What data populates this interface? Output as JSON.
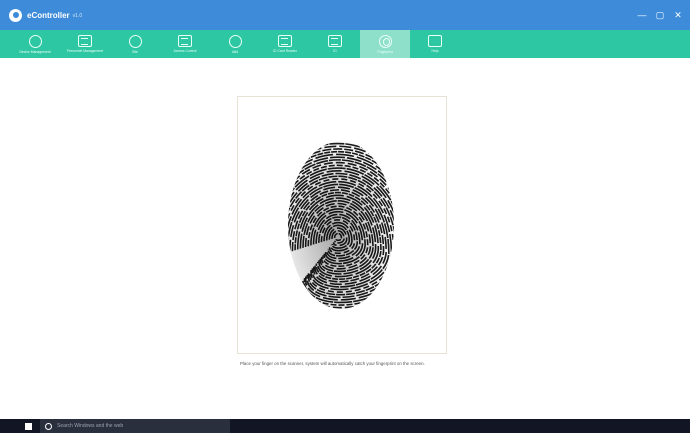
{
  "window": {
    "title": "eController",
    "version": "v1.0",
    "controls": {
      "minimize": "—",
      "maximize": "▢",
      "close": "✕"
    }
  },
  "toolbar": {
    "items": [
      {
        "label": "Device Management",
        "icon": "plus-circle-icon",
        "active": false
      },
      {
        "label": "Personnel Management",
        "icon": "calendar-icon",
        "active": false
      },
      {
        "label": "Site",
        "icon": "globe-icon",
        "active": false
      },
      {
        "label": "Access Control",
        "icon": "access-control-icon",
        "active": false
      },
      {
        "label": "Attd",
        "icon": "camera-icon",
        "active": false
      },
      {
        "label": "ID Card Reader",
        "icon": "card-reader-icon",
        "active": false
      },
      {
        "label": "ID",
        "icon": "id-icon",
        "active": false
      },
      {
        "label": "Fingerprint",
        "icon": "fingerprint-icon",
        "active": true
      },
      {
        "label": "Help",
        "icon": "help-icon",
        "active": false
      }
    ]
  },
  "main": {
    "instruction": "Place your finger on the scanner, system will automatically catch your fingerprint on the screen."
  },
  "taskbar": {
    "search_placeholder": "Search Windows and the web"
  },
  "colors": {
    "titlebar": "#3d8bd9",
    "toolbar": "#2ec7a3",
    "toolbar_active": "#8fe0cb",
    "taskbar": "#121624"
  }
}
